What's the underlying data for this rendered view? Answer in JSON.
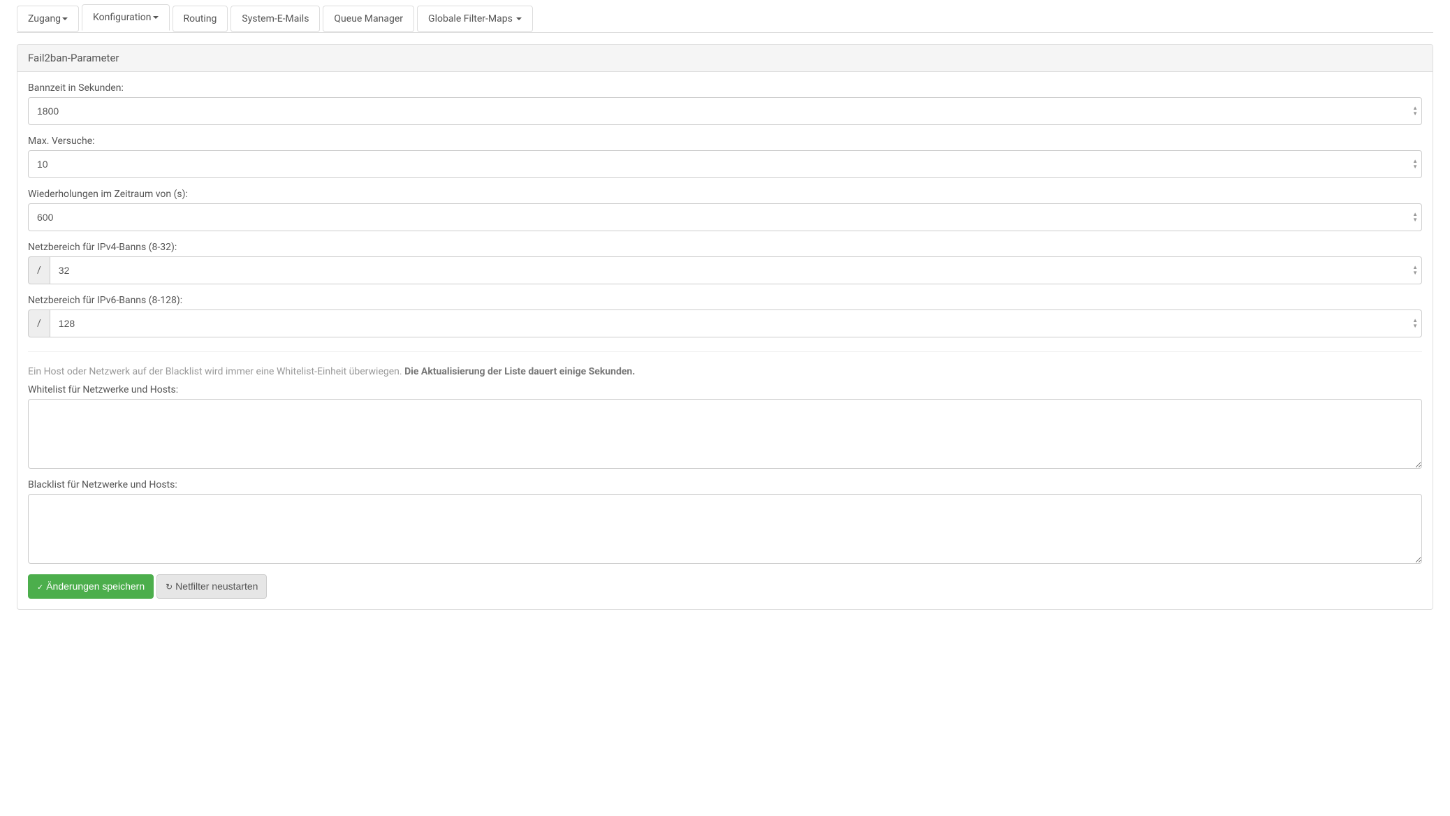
{
  "tabs": {
    "zugang": "Zugang",
    "konfiguration": "Konfiguration",
    "routing": "Routing",
    "system_emails": "System-E-Mails",
    "queue_manager": "Queue Manager",
    "globale_filter_maps": "Globale Filter-Maps"
  },
  "panel": {
    "title": "Fail2ban-Parameter"
  },
  "form": {
    "ban_time_label": "Bannzeit in Sekunden:",
    "ban_time_value": "1800",
    "max_attempts_label": "Max. Versuche:",
    "max_attempts_value": "10",
    "retry_window_label": "Wiederholungen im Zeitraum von (s):",
    "retry_window_value": "600",
    "ipv4_label": "Netzbereich für IPv4-Banns (8-32):",
    "ipv4_prefix": "/",
    "ipv4_value": "32",
    "ipv6_label": "Netzbereich für IPv6-Banns (8-128):",
    "ipv6_prefix": "/",
    "ipv6_value": "128",
    "hint_text": "Ein Host oder Netzwerk auf der Blacklist wird immer eine Whitelist-Einheit überwiegen. ",
    "hint_bold": "Die Aktualisierung der Liste dauert einige Sekunden.",
    "whitelist_label": "Whitelist für Netzwerke und Hosts:",
    "whitelist_value": "",
    "blacklist_label": "Blacklist für Netzwerke und Hosts:",
    "blacklist_value": ""
  },
  "buttons": {
    "save": "Änderungen speichern",
    "restart": "Netfilter neustarten"
  }
}
